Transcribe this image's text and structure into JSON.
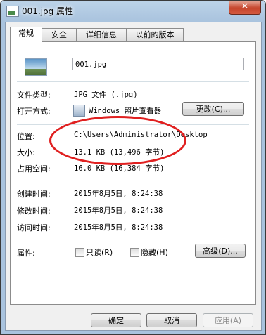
{
  "window": {
    "title": "001.jpg 属性",
    "close_glyph": "✕"
  },
  "tabs": [
    {
      "label": "常规"
    },
    {
      "label": "安全"
    },
    {
      "label": "详细信息"
    },
    {
      "label": "以前的版本"
    }
  ],
  "general": {
    "file_name": "001.jpg",
    "file_type_label": "文件类型:",
    "file_type_value": "JPG 文件 (.jpg)",
    "open_with_label": "打开方式:",
    "open_with_value": "Windows 照片查看器",
    "change_button": "更改(C)...",
    "location_label": "位置:",
    "location_value": "C:\\Users\\Administrator\\Desktop",
    "size_label": "大小:",
    "size_value": "13.1 KB (13,496 字节)",
    "size_on_disk_label": "占用空间:",
    "size_on_disk_value": "16.0 KB (16,384 字节)",
    "created_label": "创建时间:",
    "created_value": "2015年8月5日, 8:24:38",
    "modified_label": "修改时间:",
    "modified_value": "2015年8月5日, 8:24:38",
    "accessed_label": "访问时间:",
    "accessed_value": "2015年8月5日, 8:24:38",
    "attributes_label": "属性:",
    "readonly_label": "只读(R)",
    "hidden_label": "隐藏(H)",
    "advanced_button": "高级(D)..."
  },
  "footer": {
    "ok": "确定",
    "cancel": "取消",
    "apply": "应用(A)"
  },
  "colors": {
    "annotation": "#e02020",
    "titlebar": "#a9c3de",
    "close_button": "#c6452c"
  }
}
